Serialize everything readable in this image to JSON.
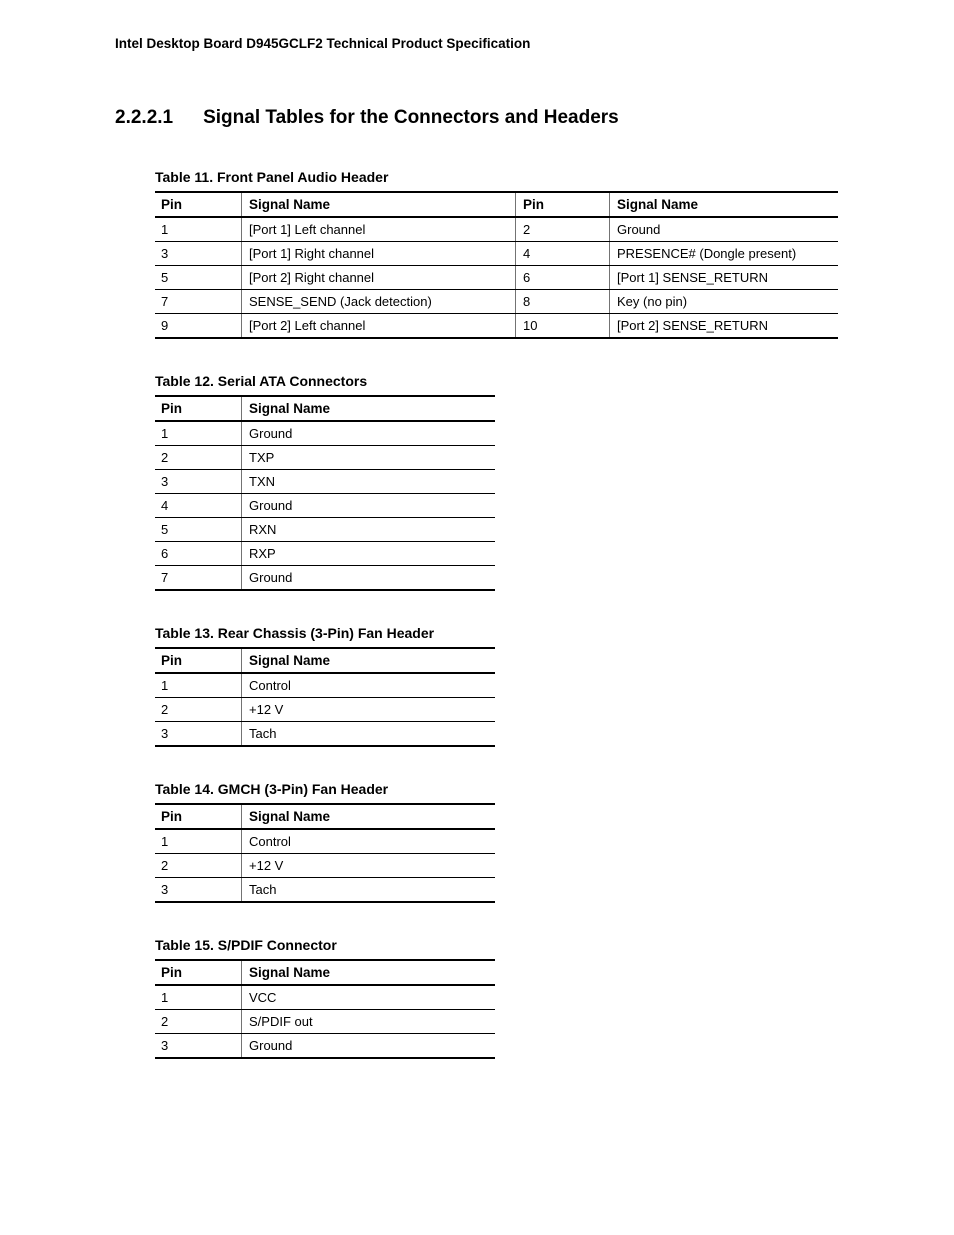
{
  "running_head": "Intel Desktop Board D945GCLF2 Technical Product Specification",
  "section": {
    "number": "2.2.2.1",
    "title": "Signal Tables for the Connectors and Headers"
  },
  "labels": {
    "pin": "Pin",
    "signal": "Signal Name"
  },
  "tables": {
    "t11": {
      "title": "Table 11.  Front Panel Audio Header",
      "rows": [
        {
          "p1": "1",
          "s1": "[Port 1] Left channel",
          "p2": "2",
          "s2": "Ground"
        },
        {
          "p1": "3",
          "s1": "[Port 1] Right channel",
          "p2": "4",
          "s2": "PRESENCE# (Dongle present)"
        },
        {
          "p1": "5",
          "s1": "[Port 2] Right channel",
          "p2": "6",
          "s2": "[Port 1] SENSE_RETURN"
        },
        {
          "p1": "7",
          "s1": "SENSE_SEND (Jack detection)",
          "p2": "8",
          "s2": "Key (no pin)"
        },
        {
          "p1": "9",
          "s1": "[Port 2] Left channel",
          "p2": "10",
          "s2": "[Port 2] SENSE_RETURN"
        }
      ]
    },
    "t12": {
      "title": "Table 12.  Serial ATA Connectors",
      "rows": [
        {
          "p": "1",
          "s": "Ground"
        },
        {
          "p": "2",
          "s": "TXP"
        },
        {
          "p": "3",
          "s": "TXN"
        },
        {
          "p": "4",
          "s": "Ground"
        },
        {
          "p": "5",
          "s": "RXN"
        },
        {
          "p": "6",
          "s": "RXP"
        },
        {
          "p": "7",
          "s": "Ground"
        }
      ]
    },
    "t13": {
      "title": "Table 13.  Rear Chassis (3-Pin) Fan Header",
      "rows": [
        {
          "p": "1",
          "s": "Control"
        },
        {
          "p": "2",
          "s": "+12 V"
        },
        {
          "p": "3",
          "s": "Tach"
        }
      ]
    },
    "t14": {
      "title": "Table 14.  GMCH (3-Pin) Fan Header",
      "rows": [
        {
          "p": "1",
          "s": "Control"
        },
        {
          "p": "2",
          "s": "+12 V"
        },
        {
          "p": "3",
          "s": "Tach"
        }
      ]
    },
    "t15": {
      "title": "Table 15.  S/PDIF Connector",
      "rows": [
        {
          "p": "1",
          "s": "VCC"
        },
        {
          "p": "2",
          "s": "S/PDIF out"
        },
        {
          "p": "3",
          "s": "Ground"
        }
      ]
    }
  }
}
